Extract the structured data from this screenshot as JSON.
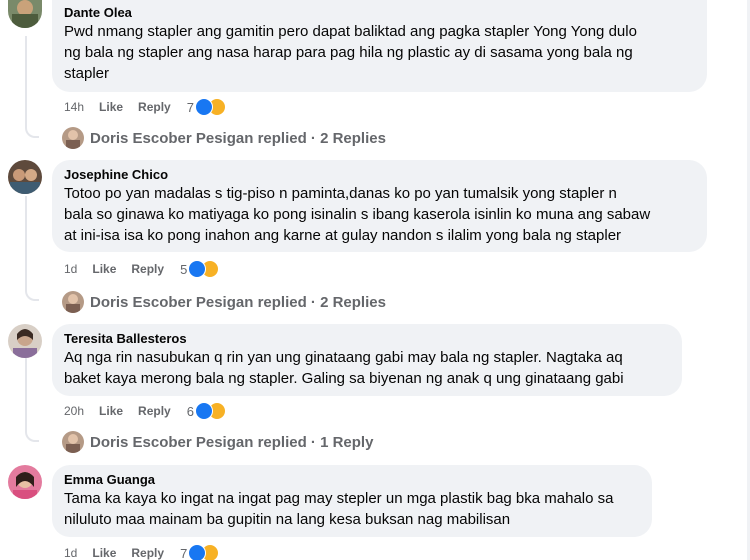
{
  "comments": [
    {
      "author": "Dante Olea",
      "lines": [
        "Pwd nmang stapler ang gamitin pero dapat baliktad ang pagka stapler Yong Yong dulo",
        "ng bala ng stapler ang nasa harap para pag hila ng plastic ay di sasama yong bala ng",
        "stapler"
      ],
      "time": "14h",
      "like_label": "Like",
      "reply_label": "Reply",
      "reaction_count": "7",
      "reactions": [
        "like-icon",
        "care-icon"
      ],
      "replies_text": "Doris Escober Pesigan replied · 2 Replies"
    },
    {
      "author": "Josephine Chico",
      "lines": [
        "Totoo po yan madalas s tig-piso n paminta,danas ko po yan tumalsik yong stapler n",
        "bala so ginawa ko matiyaga ko pong isinalin s ibang kaserola isinlin ko muna ang sabaw",
        "at ini-isa isa ko pong inahon ang karne at gulay nandon s ilalim yong bala ng stapler"
      ],
      "time": "1d",
      "like_label": "Like",
      "reply_label": "Reply",
      "reaction_count": "5",
      "reactions": [
        "like-icon",
        "care-icon"
      ],
      "replies_text": "Doris Escober Pesigan replied · 2 Replies"
    },
    {
      "author": "Teresita Ballesteros",
      "lines": [
        "Aq nga rin nasubukan q rin yan ung ginataang gabi may bala ng stapler. Nagtaka aq",
        "baket kaya merong bala ng stapler. Galing sa biyenan ng anak q ung ginataang gabi"
      ],
      "time": "20h",
      "like_label": "Like",
      "reply_label": "Reply",
      "reaction_count": "6",
      "reactions": [
        "like-icon",
        "care-icon"
      ],
      "replies_text": "Doris Escober Pesigan replied · 1 Reply"
    },
    {
      "author": "Emma Guanga",
      "lines": [
        "Tama ka kaya ko ingat na ingat pag may stepler un mga plastik bag bka mahalo sa",
        "niluluto maa mainam ba gupitin na lang kesa buksan nag mabilisan"
      ],
      "time": "1d",
      "like_label": "Like",
      "reply_label": "Reply",
      "reaction_count": "7",
      "reactions": [
        "like-icon",
        "care-icon"
      ]
    }
  ],
  "colors": {
    "bubble": "#f0f2f5",
    "meta_text": "#65676b",
    "like_blue": "#1877f2",
    "care_yellow": "#f7b125"
  }
}
